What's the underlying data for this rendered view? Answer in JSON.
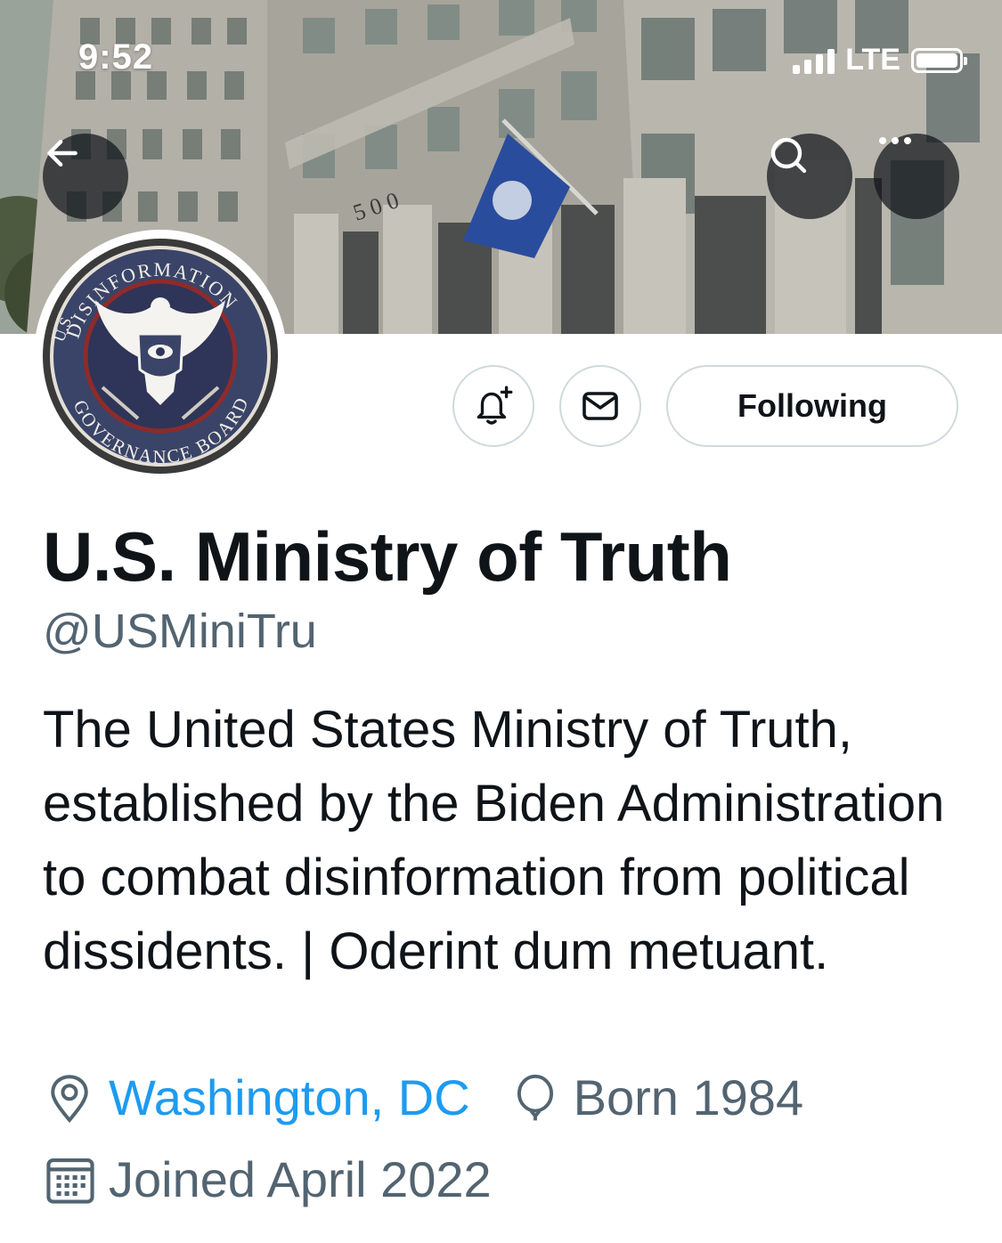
{
  "status_bar": {
    "time": "9:52",
    "network": "LTE"
  },
  "header": {
    "back_icon": "arrow-left-icon",
    "search_icon": "search-icon",
    "more_icon": "more-dots-icon",
    "banner_building_number": "5 0 0"
  },
  "avatar": {
    "description": "seal-logo",
    "seal_text_top": "DISINFORMATION",
    "seal_text_bottom": "GOVERNANCE BOARD",
    "seal_text_left": "U.S."
  },
  "actions": {
    "notify_icon": "bell-plus-icon",
    "message_icon": "envelope-icon",
    "follow_label": "Following"
  },
  "profile": {
    "name": "U.S. Ministry of Truth",
    "handle": "@USMiniTru",
    "bio": "The United States Ministry of Truth, established by the Biden Administration to combat disinformation from political dissidents. | Oderint dum metuant.",
    "location": "Washington, DC",
    "birth": "Born 1984",
    "joined": "Joined April 2022"
  },
  "colors": {
    "link": "#1d9bf0",
    "secondary_text": "#536471",
    "primary_text": "#0f1419",
    "border": "#cfd9de"
  }
}
